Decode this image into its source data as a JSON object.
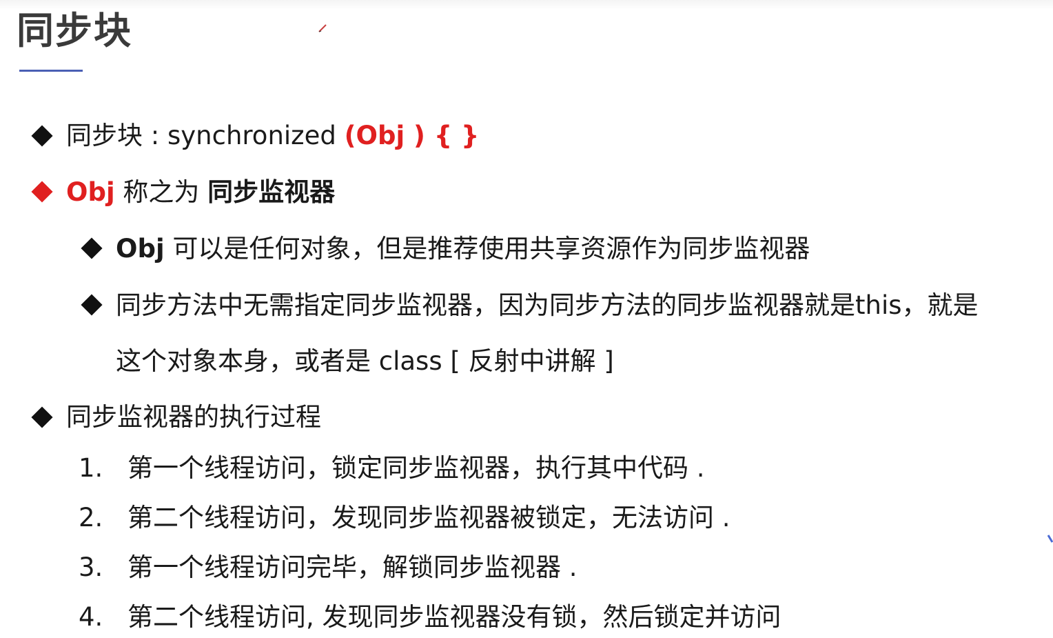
{
  "slide": {
    "title": "同步块",
    "colors": {
      "accent_red": "#e02020",
      "underline_blue": "#4a5fb4",
      "text": "#1a1a1a"
    },
    "bullets": [
      {
        "prefix": "同步块 : synchronized ",
        "highlight": "(Obj ) { }"
      },
      {
        "lead": "Obj",
        "middle": " 称之为 ",
        "emph": "同步监视器"
      }
    ],
    "sub_bullets": [
      {
        "lead": "Obj",
        "rest": " 可以是任何对象，但是推荐使用共享资源作为同步监视器"
      },
      {
        "line1": "同步方法中无需指定同步监视器，因为同步方法的同步监视器就是this，就是",
        "line2": "这个对象本身，或者是 class [ 反射中讲解 ]"
      }
    ],
    "process_heading": "同步监视器的执行过程",
    "steps": [
      {
        "num": "1.",
        "text": "第一个线程访问，锁定同步监视器，执行其中代码 ."
      },
      {
        "num": "2.",
        "text": "第二个线程访问，发现同步监视器被锁定，无法访问 ."
      },
      {
        "num": "3.",
        "text": "第一个线程访问完毕，解锁同步监视器 ."
      },
      {
        "num": "4.",
        "text": "第二个线程访问, 发现同步监视器没有锁，然后锁定并访问"
      }
    ]
  }
}
